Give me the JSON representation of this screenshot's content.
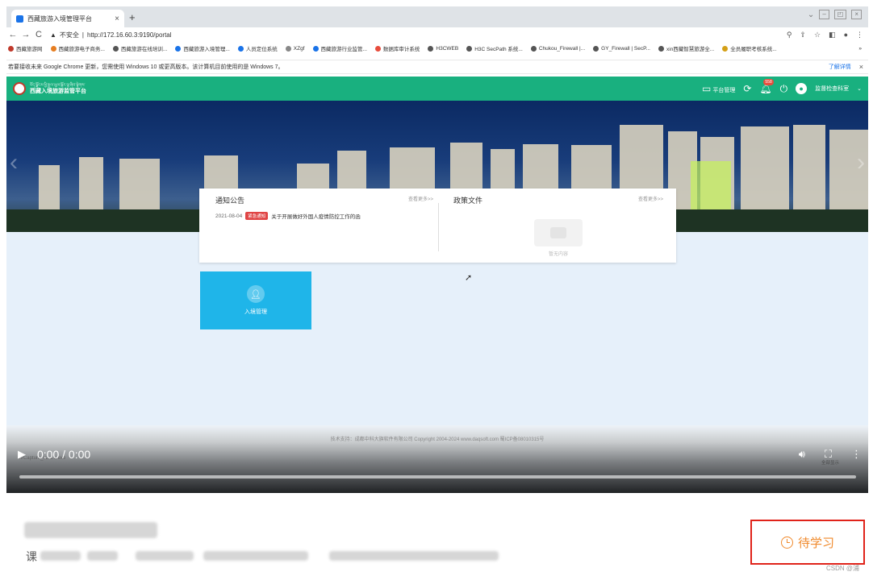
{
  "browser": {
    "tab_title": "西藏旅游入境管理平台",
    "tab_close": "×",
    "new_tab": "+",
    "url": "http://172.16.60.3:9190/portal",
    "security_label": "不安全",
    "nav": {
      "back": "←",
      "forward": "→",
      "reload": "C"
    },
    "bookmarks": [
      "西藏旅游网",
      "西藏旅游电子商务...",
      "西藏旅游在线培训...",
      "西藏旅游入境管理...",
      "人员定位系统",
      "XZgf",
      "西藏旅游行业监管...",
      "数据库审计系统",
      "H3CWEB",
      "H3C SecPath 系统...",
      "Chukou_Firewall |...",
      "GY_Firewall | SecP...",
      "xin西藏智慧旅游全...",
      "全员履职考核系统..."
    ],
    "bookmarks_more": "»",
    "infobar_text": "若要接收未来 Google Chrome 更新，您需使用 Windows 10 或更高版本。该计算机目前使用的是 Windows 7。",
    "infobar_link": "了解详情",
    "infobar_close": "×"
  },
  "app": {
    "brand_tibetan": "བོད་ལྗོངས་ཕྱི་རྒྱལ་ཡུལ་སྐོར་ལྟ་ཞིབ་སྟེགས་",
    "brand_name": "西藏入境旅游监管平台",
    "platform_manage": "平台管理",
    "notification_count": "558",
    "user_name": "监督检查科室"
  },
  "notice_panel": {
    "announce_title": "通知公告",
    "announce_more": "查看更多>>",
    "notice_date": "2021-08-04",
    "notice_tag": "紧急通知",
    "notice_text": "关于开展做好外国人疫情防控工作的函",
    "policy_title": "政策文件",
    "policy_more": "查看更多>>",
    "empty_text": "暂无内容"
  },
  "tile": {
    "label": "入境管理"
  },
  "footer": {
    "text": "技术支持：成都中科大旗软件有限公司 Copyright 2004-2024 www.daqsoft.com 蜀ICP备08010315号"
  },
  "video": {
    "time": "0:00 / 0:00",
    "download_chip": "LVCapture_v2.1.5.exe",
    "show_all": "全部显示"
  },
  "study": {
    "label": "待学习"
  },
  "credit": "CSDN @浦"
}
